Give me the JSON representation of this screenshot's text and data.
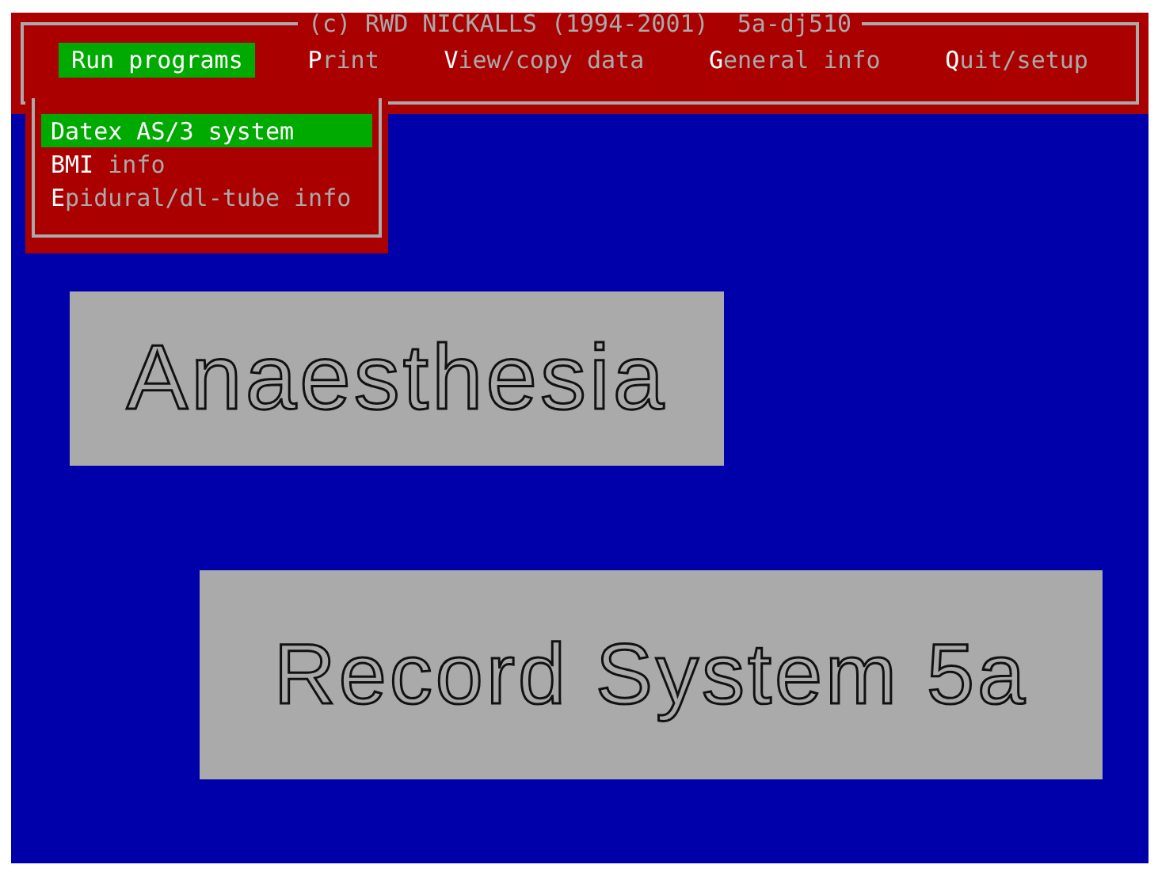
{
  "title": "(c) RWD NICKALLS (1994-2001)",
  "version": "5a-dj510",
  "menu": [
    {
      "label": "Run programs",
      "selected": true
    },
    {
      "label": "**P**rint",
      "selected": false
    },
    {
      "label": "**V**iew/copy data",
      "selected": false
    },
    {
      "label": "**G**eneral info",
      "selected": false
    },
    {
      "label": "**Q**uit/setup",
      "selected": false
    }
  ],
  "submenu": [
    {
      "label": "Datex AS/3 system",
      "selected": true
    },
    {
      "label": "**BMI** info",
      "selected": false
    },
    {
      "label": "**E**pidural/dl-tube info",
      "selected": false
    }
  ],
  "banners": [
    "Anaesthesia",
    "Record System 5a"
  ]
}
